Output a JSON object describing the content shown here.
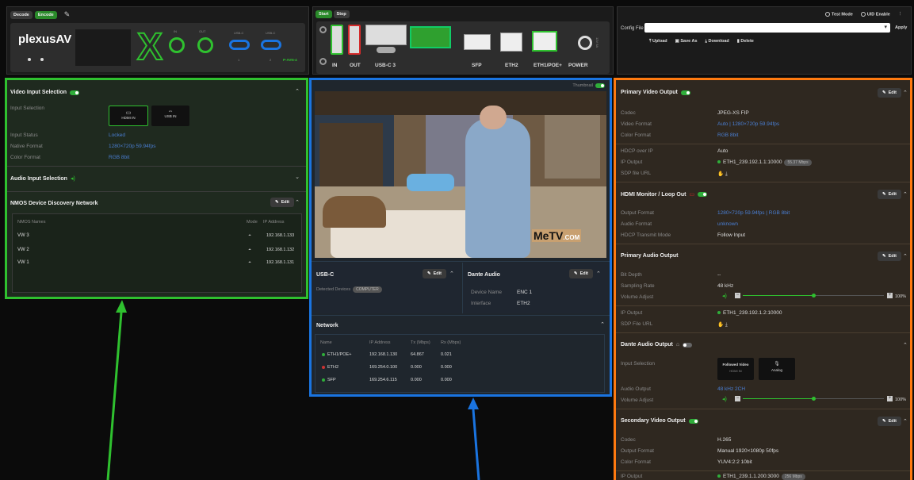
{
  "top": {
    "decode": "Decode",
    "encode": "Encode",
    "brand": "plexusAV",
    "model": "P-AVN-4",
    "port_labels": [
      "IN",
      "OUT",
      "USB-C",
      "USB-C"
    ],
    "port_nums": [
      "1",
      "2"
    ]
  },
  "mid": {
    "start": "Start",
    "stop": "Stop",
    "ports": [
      "IN",
      "OUT",
      "USB-C 3",
      "SFP",
      "ETH2",
      "ETH1/POE+",
      "POWER"
    ],
    "power_sub": "12V 5A"
  },
  "right_top": {
    "test_mode": "Test Mode",
    "uid_enable": "UID Enable",
    "config_label": "Config File",
    "apply": "Apply",
    "upload": "Upload",
    "save_as": "Save As",
    "download": "Download",
    "delete": "Delete"
  },
  "left": {
    "video_input": {
      "title": "Video Input Selection",
      "input_selection": "Input Selection",
      "hdmi": "HDMI IN",
      "usb": "USB IN",
      "rows": [
        {
          "k": "Input Status",
          "v": "Locked"
        },
        {
          "k": "Native Format",
          "v": "1280×720p 59.94fps"
        },
        {
          "k": "Color Format",
          "v": "RGB 8bit"
        }
      ]
    },
    "audio_input": {
      "title": "Audio Input Selection"
    },
    "nmos": {
      "title": "NMOS Device Discovery Network",
      "edit": "Edit",
      "col_names": "NMOS Names",
      "col_mode": "Mode",
      "col_ip": "IP Address",
      "rows": [
        {
          "name": "VW 3",
          "ip": "192.168.1.133"
        },
        {
          "name": "VW 2",
          "ip": "192.168.1.132"
        },
        {
          "name": "VW 1",
          "ip": "192.168.1.131"
        }
      ]
    }
  },
  "center": {
    "thumbnail": "Thumbnail",
    "logo": "MeTV",
    "logo_suffix": ".COM",
    "usbc": {
      "title": "USB-C",
      "edit": "Edit",
      "detected": "Detected Devices",
      "badge": "COMPUTER"
    },
    "dante": {
      "title": "Dante Audio",
      "edit": "Edit",
      "device_k": "Device Name",
      "device_v": "ENC 1",
      "iface_k": "Interface",
      "iface_v": "ETH2"
    },
    "network": {
      "title": "Network",
      "headers": [
        "Name",
        "IP Address",
        "Tx (Mbps)",
        "Rx (Mbps)"
      ],
      "rows": [
        {
          "name": "ETH1/POE+",
          "ip": "192.168.1.130",
          "tx": "64.867",
          "rx": "0.021",
          "status": "green"
        },
        {
          "name": "ETH2",
          "ip": "169.254.0.100",
          "tx": "0.000",
          "rx": "0.000",
          "status": "red"
        },
        {
          "name": "SFP",
          "ip": "169.254.6.115",
          "tx": "0.000",
          "rx": "0.000",
          "status": "green"
        }
      ]
    }
  },
  "right": {
    "primary_video": {
      "title": "Primary Video Output",
      "edit": "Edit",
      "rows": [
        {
          "k": "Codec",
          "v": "JPEG-XS FIP"
        },
        {
          "k": "Video Format",
          "v": "Auto | 1280×720p 59.94fps"
        },
        {
          "k": "Color Format",
          "v": "RGB 8bit"
        },
        {
          "k": "HDCP over IP",
          "v": "Auto"
        },
        {
          "k": "IP Output",
          "v": "ETH1_239.192.1.1:10000",
          "badge": "55.37 Mbps"
        },
        {
          "k": "SDP file URL",
          "v": ""
        }
      ]
    },
    "hdmi_loop": {
      "title": "HDMI Monitor / Loop Out",
      "edit": "Edit",
      "rows": [
        {
          "k": "Output Format",
          "v": "1280×720p 59.94fps | RGB 8bit"
        },
        {
          "k": "Audio Format",
          "v": "unknown"
        },
        {
          "k": "HDCP Transmit Mode",
          "v": "Follow Input"
        }
      ]
    },
    "primary_audio": {
      "title": "Primary Audio Output",
      "edit": "Edit",
      "rows": [
        {
          "k": "Bit Depth",
          "v": "--"
        },
        {
          "k": "Sampling Rate",
          "v": "48 kHz"
        },
        {
          "k": "Volume Adjust",
          "v": "100%",
          "level": 0.5
        },
        {
          "k": "IP Output",
          "v": "ETH1_239.192.1.2:10000"
        },
        {
          "k": "SDP File URL",
          "v": ""
        }
      ]
    },
    "dante_out": {
      "title": "Dante Audio Output",
      "input_selection": "Input Selection",
      "opt1": "Followed Video",
      "opt1_sub": "HDMI IN",
      "opt2": "Analog",
      "audio_output_k": "Audio Output",
      "audio_output_v": "48 kHz 2CH",
      "volume_k": "Volume Adjust",
      "volume_v": "100%",
      "level": 0.5
    },
    "secondary_video": {
      "title": "Secondary Video Output",
      "edit": "Edit",
      "rows": [
        {
          "k": "Codec",
          "v": "H.265"
        },
        {
          "k": "Output Format",
          "v": "Manual 1920×1080p 50fps"
        },
        {
          "k": "Color Format",
          "v": "YUV4:2:2 10bit"
        },
        {
          "k": "IP Output",
          "v": "ETH1_239.1.1.200:3000",
          "badge": "256 Mbps"
        }
      ]
    }
  },
  "colors": {
    "green": "#2fc12f",
    "blue": "#1a74e0",
    "orange": "#ff7a10"
  }
}
